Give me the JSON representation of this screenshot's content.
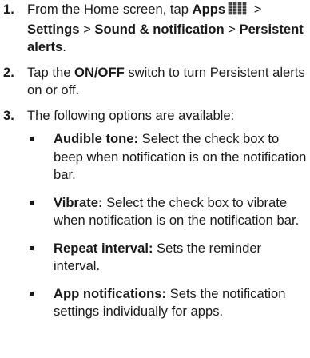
{
  "steps": [
    {
      "number": "1.",
      "text_pre": "From the Home screen, tap ",
      "apps": "Apps",
      "apps_icon": "apps-grid-icon",
      "sep1": " > ",
      "settings": "Settings",
      "sep2": " > ",
      "sound": "Sound & notification",
      "sep3": " > ",
      "persistent": "Persistent alerts",
      "end": "."
    },
    {
      "number": "2.",
      "text_pre": "Tap the ",
      "switch_label": "ON/OFF",
      "text_post": " switch to turn Persistent alerts on or off."
    },
    {
      "number": "3.",
      "text": "The following options are available:"
    }
  ],
  "options": [
    {
      "term": "Audible tone:",
      "desc": " Select the check box to beep when notification is on the notification bar."
    },
    {
      "term": "Vibrate:",
      "desc": " Select the check box to vibrate when notification is on the notification bar."
    },
    {
      "term": "Repeat interval:",
      "desc": " Sets the reminder interval."
    },
    {
      "term": "App notifications:",
      "desc": " Sets the notification settings individually for apps."
    }
  ]
}
